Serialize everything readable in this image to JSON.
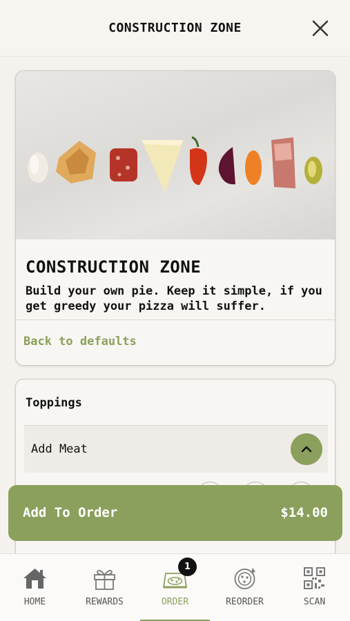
{
  "header": {
    "title": "CONSTRUCTION ZONE"
  },
  "hero": {
    "title": "CONSTRUCTION ZONE",
    "description": "Build your own pie. Keep it simple, if you get greedy your pizza will suffer.",
    "back_link": "Back to defaults"
  },
  "toppings": {
    "section_label": "Toppings",
    "group_label": "Add Meat"
  },
  "order_button": {
    "label": "Add To Order",
    "price": "$14.00"
  },
  "tabs": [
    {
      "label": "HOME",
      "icon": "home-icon"
    },
    {
      "label": "REWARDS",
      "icon": "gift-icon"
    },
    {
      "label": "ORDER",
      "icon": "pizza-box-icon",
      "active": true
    },
    {
      "label": "REORDER",
      "icon": "reorder-icon"
    },
    {
      "label": "SCAN",
      "icon": "qr-code-icon"
    }
  ],
  "order_badge": "1",
  "colors": {
    "accent": "#8ba05c",
    "background": "#f5f2ee",
    "text": "#111111"
  }
}
